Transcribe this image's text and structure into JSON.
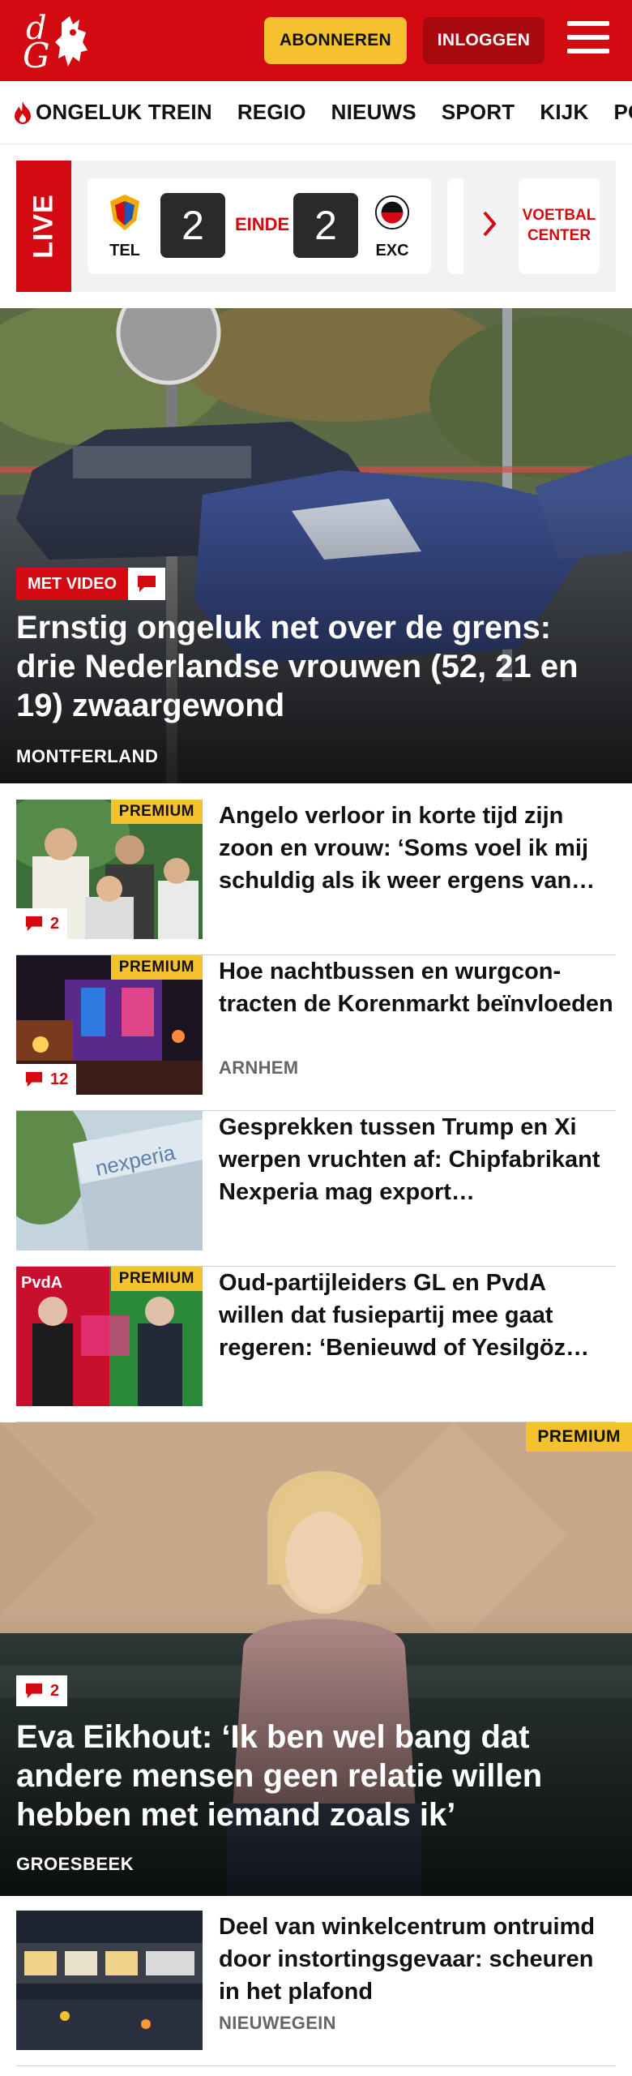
{
  "header": {
    "logo_letters": "dG",
    "subscribe_label": "ABONNEREN",
    "login_label": "INLOGGEN"
  },
  "nav": {
    "items": [
      "ONGELUK TREIN",
      "REGIO",
      "NIEUWS",
      "SPORT",
      "KIJK",
      "PODCAST"
    ]
  },
  "live": {
    "label": "LIVE",
    "match": {
      "home_team": "TEL",
      "away_team": "EXC",
      "home_score": "2",
      "away_score": "2",
      "status": "EINDE"
    },
    "voetbal_center_label": "VOETBAL CENTER"
  },
  "hero1": {
    "badge": "MET VIDEO",
    "title": "Ernstig ongeluk net over de grens: drie Nederlandse vrouwen (52, 21 en 19) zwaargewond",
    "location": "MONTFERLAND"
  },
  "articles": [
    {
      "title": "Angelo verloor in korte tijd zijn zoon en vrouw: ‘Soms voel ik mij schuldig als ik weer ergens van…",
      "premium": "PREMIUM",
      "comments": "2",
      "location": ""
    },
    {
      "title": "Hoe nachtbussen en wurgcon­tracten de Korenmarkt beïnvloe­den",
      "premium": "PREMIUM",
      "comments": "12",
      "location": "ARNHEM"
    },
    {
      "title": "Gesprekken tussen Trump en Xi werpen vruchten af: Chipfabri­kant Nexperia mag export…",
      "premium": "",
      "comments": "",
      "location": ""
    },
    {
      "title": "Oud-partijleiders GL en PvdA willen dat fusiepartij mee gaat regeren: ‘Benieuwd of Yesilgöz…",
      "premium": "PREMIUM",
      "comments": "",
      "location": ""
    }
  ],
  "hero2": {
    "premium": "PREMIUM",
    "comments": "2",
    "title": "Eva Eikhout: ‘Ik ben wel bang dat andere mensen geen relatie willen hebben met iemand zoals ik’",
    "location": "GROESBEEK"
  },
  "article_after": {
    "title": "Deel van winkelcentrum ontruimd door instortingsgevaar: scheuren in het plafond",
    "location": "NIEUWEGEIN"
  },
  "colors": {
    "brand_red": "#d40a12",
    "premium_yellow": "#f5c12e",
    "dark_red": "#a8090f"
  }
}
